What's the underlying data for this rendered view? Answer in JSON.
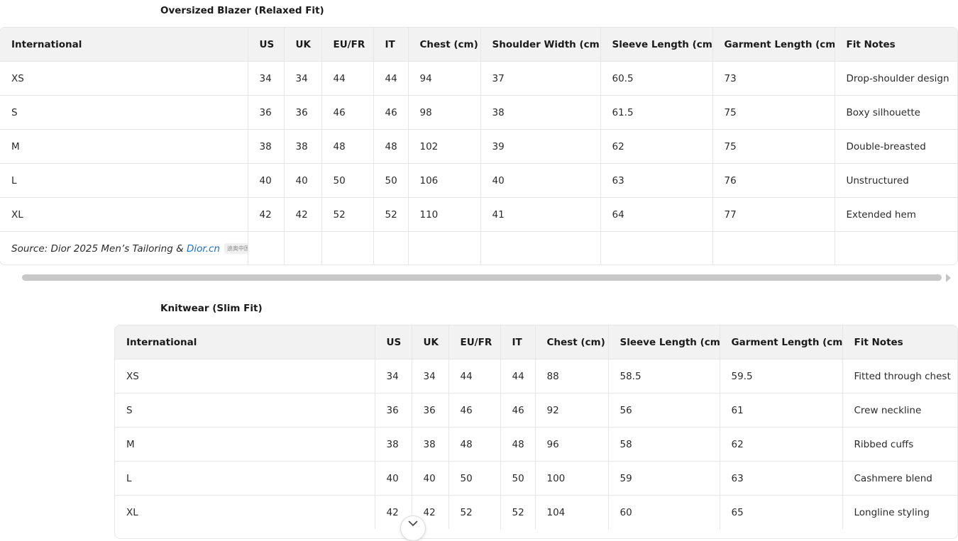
{
  "blazer": {
    "title": "Oversized Blazer (Relaxed Fit)",
    "headers": [
      "International",
      "US",
      "UK",
      "EU/FR",
      "IT",
      "Chest (cm)",
      "Shoulder Width (cm)",
      "Sleeve Length (cm)",
      "Garment Length (cm)",
      "Fit Notes"
    ],
    "rows": [
      [
        "XS",
        "34",
        "34",
        "44",
        "44",
        "94",
        "37",
        "60.5",
        "73",
        "Drop-shoulder design"
      ],
      [
        "S",
        "36",
        "36",
        "46",
        "46",
        "98",
        "38",
        "61.5",
        "75",
        "Boxy silhouette"
      ],
      [
        "M",
        "38",
        "38",
        "48",
        "48",
        "102",
        "39",
        "62",
        "75",
        "Double-breasted"
      ],
      [
        "L",
        "40",
        "40",
        "50",
        "50",
        "106",
        "40",
        "63",
        "76",
        "Unstructured"
      ],
      [
        "XL",
        "42",
        "42",
        "52",
        "52",
        "110",
        "41",
        "64",
        "77",
        "Extended hem"
      ]
    ],
    "source": {
      "prefix": "Source: Dior 2025 Men’s Tailoring & ",
      "link_text": "Dior.cn",
      "badge": "迪奥中国"
    }
  },
  "knitwear": {
    "title": "Knitwear (Slim Fit)",
    "headers": [
      "International",
      "US",
      "UK",
      "EU/FR",
      "IT",
      "Chest (cm)",
      "Sleeve Length (cm)",
      "Garment Length (cm)",
      "Fit Notes"
    ],
    "rows": [
      [
        "XS",
        "34",
        "34",
        "44",
        "44",
        "88",
        "58.5",
        "59.5",
        "Fitted through chest"
      ],
      [
        "S",
        "36",
        "36",
        "46",
        "46",
        "92",
        "56",
        "61",
        "Crew neckline"
      ],
      [
        "M",
        "38",
        "38",
        "48",
        "48",
        "96",
        "58",
        "62",
        "Ribbed cuffs"
      ],
      [
        "L",
        "40",
        "40",
        "50",
        "50",
        "100",
        "59",
        "63",
        "Cashmere blend"
      ],
      [
        "XL",
        "42",
        "42",
        "52",
        "52",
        "104",
        "60",
        "65",
        "Longline styling"
      ]
    ]
  },
  "icons": {
    "scroll_right": "triangle-right-icon",
    "scroll_down": "chevron-down-icon"
  },
  "colors": {
    "header_bg": "#f2f2f2",
    "border": "#e6e6e6",
    "link": "#1a6ed8",
    "scrollbar": "#c8c8c8"
  }
}
